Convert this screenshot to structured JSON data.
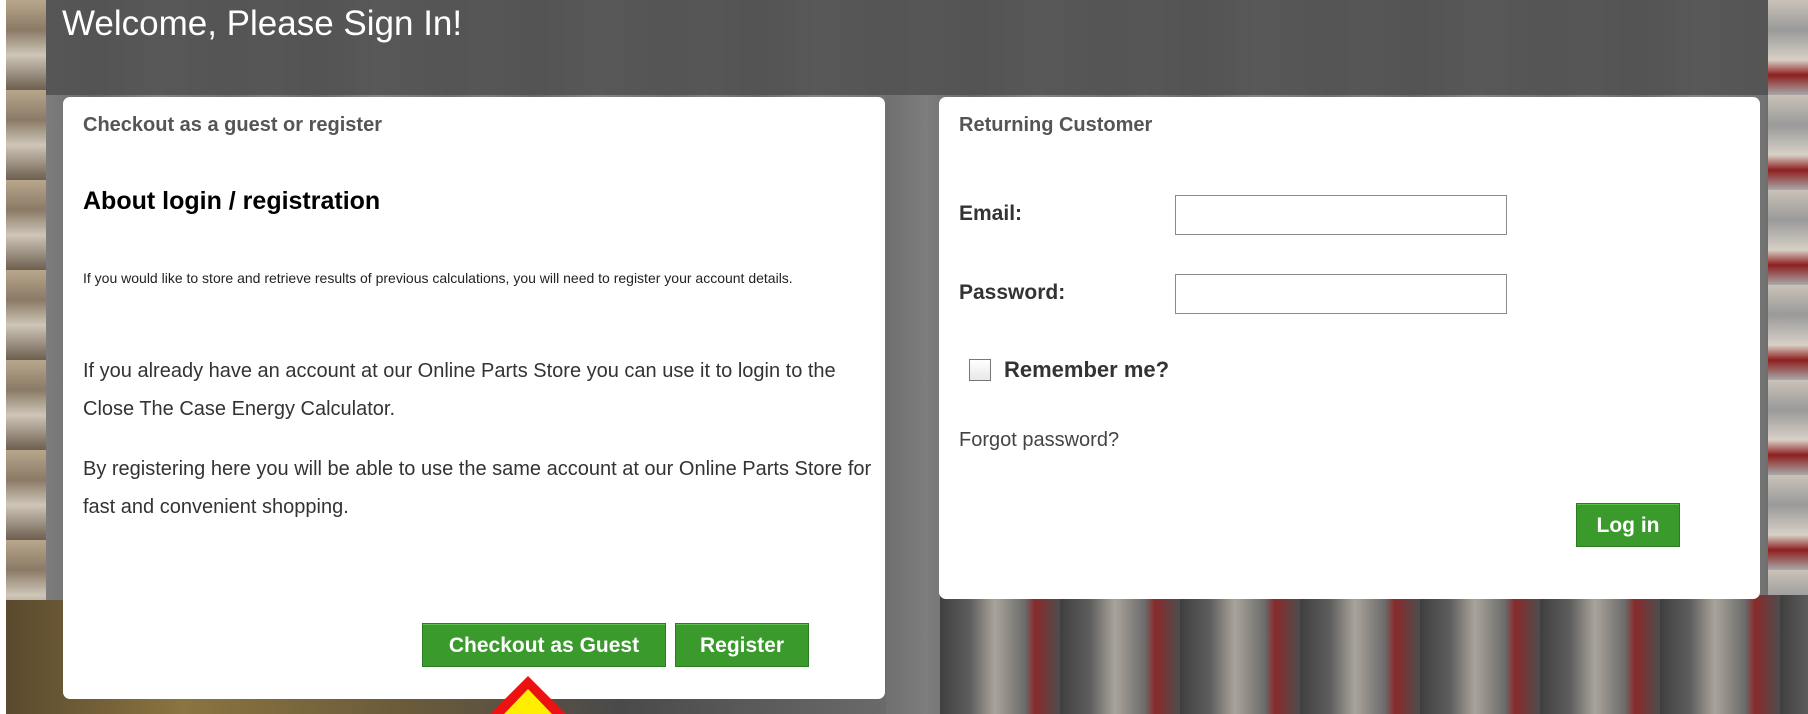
{
  "page": {
    "title": "Welcome, Please Sign In!"
  },
  "guest_panel": {
    "subtitle": "Checkout as a guest or register",
    "section_title": "About login / registration",
    "small_text": "If you would like to store and retrieve results of previous calculations, you will need to register your account details.",
    "paragraph1": "If you already have an account at our Online Parts Store you can use it to login to the Close The Case Energy Calculator.",
    "paragraph2": "By registering here you will be able to use the same account at our Online Parts Store for fast and convenient shopping.",
    "checkout_guest_label": "Checkout as Guest",
    "register_label": "Register"
  },
  "login_panel": {
    "subtitle": "Returning Customer",
    "email_label": "Email:",
    "email_value": "",
    "password_label": "Password:",
    "password_value": "",
    "remember_label": "Remember me?",
    "remember_checked": false,
    "forgot_label": "Forgot password?",
    "login_label": "Log in"
  },
  "colors": {
    "button_green": "#3a9a2c",
    "header_band": "#505050",
    "arrow_red": "#e11111",
    "arrow_yellow": "#ffee00"
  },
  "icons": {
    "annotation_arrow": "arrow-up-icon"
  }
}
